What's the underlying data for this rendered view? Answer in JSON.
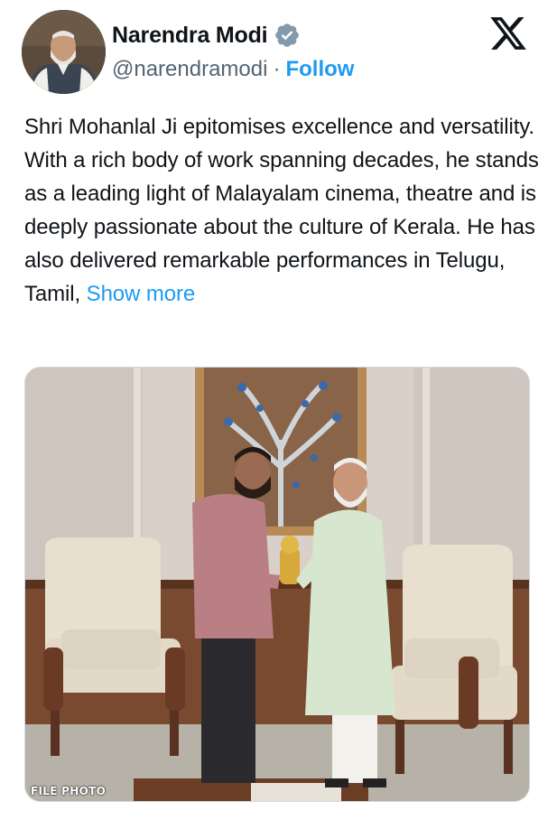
{
  "author": {
    "display_name": "Narendra Modi",
    "handle": "@narendramodi",
    "separator": "·",
    "follow_label": "Follow",
    "verified": true
  },
  "tweet": {
    "text": "Shri Mohanlal Ji epitomises excellence and versatility. With a rich body of work spanning decades, he stands as a leading light of Malayalam cinema, theatre and is deeply passionate about the culture of Kerala. He has also delivered remarkable performances in Telugu, Tamil,",
    "show_more_label": "Show more"
  },
  "media": {
    "watermark": "FILE PHOTO"
  },
  "icons": {
    "brand": "x-logo-icon",
    "verified": "verified-badge-icon"
  },
  "colors": {
    "link": "#1d9bf0",
    "secondary_text": "#536471",
    "primary_text": "#0f1419",
    "verified_badge": "#829aab"
  }
}
